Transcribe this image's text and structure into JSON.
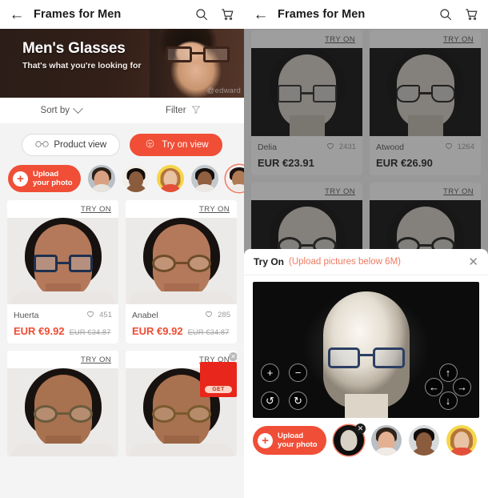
{
  "accent": "#f04e37",
  "left_screen": {
    "topbar": {
      "back_icon": "back-arrow-icon",
      "title": "Frames for Men",
      "search_icon": "search-icon",
      "cart_icon": "cart-icon"
    },
    "banner": {
      "headline": "Men's Glasses",
      "subhead": "That's what you're looking for",
      "watermark": "@edward"
    },
    "sortbar": {
      "sort_label": "Sort by",
      "sort_icon": "chevron-down-icon",
      "filter_label": "Filter",
      "filter_icon": "funnel-icon"
    },
    "view_toggle": {
      "product_view": "Product view",
      "try_on_view": "Try on view",
      "product_icon": "glasses-icon",
      "try_on_icon": "try-on-face-icon"
    },
    "upload": {
      "line1": "Upload",
      "line2": "your photo",
      "plus_icon": "plus-icon"
    },
    "avatars": [
      {
        "name": "avatar-1",
        "skin": "#d9a183",
        "hair": "#2c2018",
        "bg": "#b9bfc4",
        "selected": false
      },
      {
        "name": "avatar-2",
        "skin": "#8a5b3c",
        "hair": "#120d0a",
        "bg": "#f2efe9",
        "selected": false
      },
      {
        "name": "avatar-3",
        "skin": "#e8c3a4",
        "hair": "#b5753a",
        "bg": "#f5d64b",
        "selected": false
      },
      {
        "name": "avatar-4",
        "skin": "#91603f",
        "hair": "#161010",
        "bg": "#c3c8cc",
        "selected": false
      },
      {
        "name": "avatar-5",
        "skin": "#b07a54",
        "hair": "#1a1111",
        "bg": "#f7efee",
        "selected": true
      }
    ],
    "products": [
      {
        "try_on": "TRY ON",
        "name": "Huerta",
        "likes": "451",
        "price_now": "EUR €9.92",
        "price_was": "EUR €34.87",
        "skin": "#b4795a",
        "hair": "#17120f",
        "frame": "#20304f",
        "lens": "rgba(190,200,215,.3)"
      },
      {
        "try_on": "TRY ON",
        "name": "Anabel",
        "likes": "285",
        "price_now": "EUR €9.92",
        "price_was": "EUR €34.87",
        "skin": "#b4795a",
        "hair": "#17120f",
        "frame": "#6e4c2a",
        "lens": "rgba(220,205,185,.32)"
      }
    ],
    "products_row2": [
      {
        "try_on": "TRY ON",
        "skin": "#a8714f",
        "hair": "#201814",
        "frame": "#6b5a3c",
        "lens": "rgba(215,205,190,.3)",
        "has_ad": false
      },
      {
        "try_on": "TRY ON",
        "skin": "#a8714f",
        "hair": "#201814",
        "frame": "#7a5a2c",
        "lens": "rgba(215,200,175,.3)",
        "has_ad": true
      }
    ],
    "ad": {
      "label": "GET",
      "close_icon": "close-ad-icon"
    }
  },
  "right_screen": {
    "topbar": {
      "back_icon": "back-arrow-icon",
      "title": "Frames for Men",
      "search_icon": "search-icon",
      "cart_icon": "cart-icon"
    },
    "products": [
      {
        "try_on": "TRY ON",
        "name": "Delia",
        "likes": "2431",
        "price": "EUR €23.91",
        "frame": "#2b2b2b",
        "lens": "rgba(200,205,215,.25)"
      },
      {
        "try_on": "TRY ON",
        "name": "Atwood",
        "likes": "1264",
        "price": "EUR €26.90",
        "frame": "#1c1c1c",
        "lens": "rgba(200,205,215,.25)"
      }
    ],
    "products_row2": [
      {
        "try_on": "TRY ON",
        "frame": "#1f1f1f"
      },
      {
        "try_on": "TRY ON",
        "frame": "#1a1a1a"
      }
    ],
    "modal": {
      "title": "Try On",
      "subtitle": "(Upload pictures below 6M)",
      "close_icon": "close-icon",
      "controls_left": [
        {
          "name": "zoom-in-button",
          "glyph": "+"
        },
        {
          "name": "zoom-out-button",
          "glyph": "−"
        },
        {
          "name": "rotate-ccw-button",
          "glyph": "↺"
        },
        {
          "name": "rotate-cw-button",
          "glyph": "↻"
        }
      ],
      "controls_right": [
        {
          "name": "move-up-button",
          "glyph": "↑"
        },
        {
          "name": "move-left-button",
          "glyph": "←"
        },
        {
          "name": "move-right-button",
          "glyph": "→"
        },
        {
          "name": "move-down-button",
          "glyph": "↓"
        }
      ],
      "upload": {
        "line1": "Upload",
        "line2": "your photo",
        "plus_icon": "plus-icon"
      },
      "avatars": [
        {
          "name": "avatar-mannequin",
          "skin": "#d7d1c6",
          "hair": "#141414",
          "bg": "#0d0d0d",
          "selected": true,
          "deletable": true
        },
        {
          "name": "avatar-1",
          "skin": "#e3b191",
          "hair": "#2f231a",
          "bg": "#b9bfc4",
          "selected": false,
          "deletable": false
        },
        {
          "name": "avatar-2",
          "skin": "#8a5b3c",
          "hair": "#120d0a",
          "bg": "#d7dadd",
          "selected": false,
          "deletable": false
        },
        {
          "name": "avatar-3",
          "skin": "#e8c3a4",
          "hair": "#b5753a",
          "bg": "#f5d64b",
          "selected": false,
          "deletable": false
        }
      ]
    }
  }
}
